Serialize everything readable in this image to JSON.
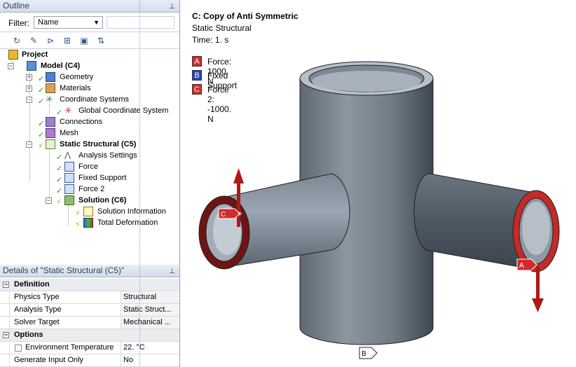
{
  "outline": {
    "title": "Outline",
    "pin": "Ⴔ",
    "filter_label": "Filter:",
    "filter_value": "Name",
    "filter_text": ""
  },
  "tree": [
    {
      "label": "Project",
      "bold": true
    },
    {
      "label": "Model (C4)",
      "bold": true
    },
    {
      "label": "Geometry",
      "bold": false
    },
    {
      "label": "Materials",
      "bold": false
    },
    {
      "label": "Coordinate Systems",
      "bold": false
    },
    {
      "label": "Global Coordinate System",
      "bold": false
    },
    {
      "label": "Connections",
      "bold": false
    },
    {
      "label": "Mesh",
      "bold": false
    },
    {
      "label": "Static Structural (C5)",
      "bold": true
    },
    {
      "label": "Analysis Settings",
      "bold": false
    },
    {
      "label": "Force",
      "bold": false
    },
    {
      "label": "Fixed Support",
      "bold": false
    },
    {
      "label": "Force 2",
      "bold": false
    },
    {
      "label": "Solution (C6)",
      "bold": true
    },
    {
      "label": "Solution Information",
      "bold": false
    },
    {
      "label": "Total Deformation",
      "bold": false
    }
  ],
  "details": {
    "title": "Details of \"Static Structural (C5)\"",
    "groups": [
      {
        "name": "Definition",
        "rows": [
          {
            "key": "Physics Type",
            "value": "Structural"
          },
          {
            "key": "Analysis Type",
            "value": "Static Struct..."
          },
          {
            "key": "Solver Target",
            "value": "Mechanical ..."
          }
        ]
      },
      {
        "name": "Options",
        "rows": [
          {
            "key": "Environment Temperature",
            "value": "22. °C"
          },
          {
            "key": "Generate Input Only",
            "value": "No"
          }
        ]
      }
    ]
  },
  "viewport": {
    "title": "C: Copy of Anti Symmetric",
    "subtitle": "Static Structural",
    "time": "Time: 1. s",
    "legend": [
      {
        "letter": "A",
        "text": "Force: 1000. N",
        "color": "#d42a2a"
      },
      {
        "letter": "B",
        "text": "Fixed Support",
        "color": "#2a3fb4"
      },
      {
        "letter": "C",
        "text": "Force 2: -1000. N",
        "color": "#d42a2a"
      }
    ],
    "tags": {
      "a": "A",
      "b": "B",
      "c": "C"
    }
  },
  "colors": {
    "accent_red": "#c8201f",
    "pipe_gray": "#7d8792",
    "panel_header": "#d3dde9"
  }
}
